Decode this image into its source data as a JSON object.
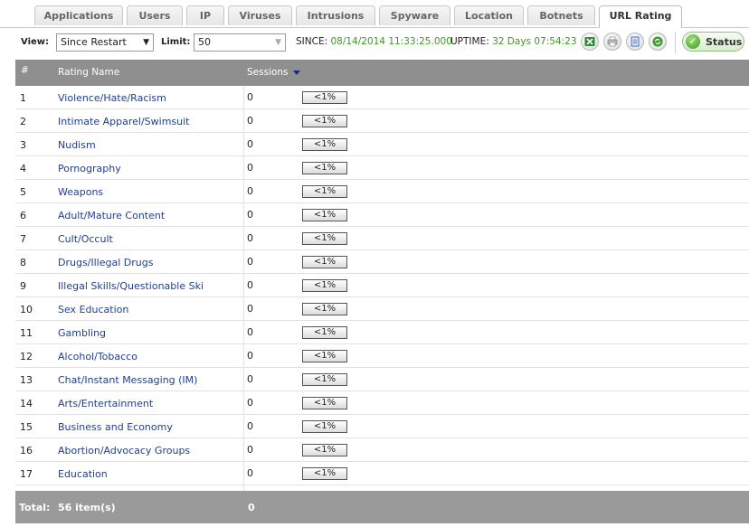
{
  "tabs": [
    {
      "label": "Applications",
      "active": false
    },
    {
      "label": "Users",
      "active": false
    },
    {
      "label": "IP",
      "active": false
    },
    {
      "label": "Viruses",
      "active": false
    },
    {
      "label": "Intrusions",
      "active": false
    },
    {
      "label": "Spyware",
      "active": false
    },
    {
      "label": "Location",
      "active": false
    },
    {
      "label": "Botnets",
      "active": false
    },
    {
      "label": "URL Rating",
      "active": true
    }
  ],
  "toolbar": {
    "view_label": "View:",
    "view_value": "Since Restart",
    "limit_label": "Limit:",
    "limit_value": "50",
    "since_label": "SINCE:",
    "since_value": "08/14/2014 11:33:25.000",
    "uptime_label": "UPTIME:",
    "uptime_value": "32 Days 07:54:23",
    "status_label": "Status",
    "icons": [
      "excel-export-icon",
      "print-icon",
      "list-icon",
      "refresh-icon"
    ]
  },
  "table": {
    "headers": {
      "num": "#",
      "name": "Rating Name",
      "sessions": "Sessions"
    },
    "rows": [
      {
        "num": "1",
        "name": "Violence/Hate/Racism",
        "sessions": "0",
        "pct": "<1%"
      },
      {
        "num": "2",
        "name": "Intimate Apparel/Swimsuit",
        "sessions": "0",
        "pct": "<1%"
      },
      {
        "num": "3",
        "name": "Nudism",
        "sessions": "0",
        "pct": "<1%"
      },
      {
        "num": "4",
        "name": "Pornography",
        "sessions": "0",
        "pct": "<1%"
      },
      {
        "num": "5",
        "name": "Weapons",
        "sessions": "0",
        "pct": "<1%"
      },
      {
        "num": "6",
        "name": "Adult/Mature Content",
        "sessions": "0",
        "pct": "<1%"
      },
      {
        "num": "7",
        "name": "Cult/Occult",
        "sessions": "0",
        "pct": "<1%"
      },
      {
        "num": "8",
        "name": "Drugs/Illegal Drugs",
        "sessions": "0",
        "pct": "<1%"
      },
      {
        "num": "9",
        "name": "Illegal Skills/Questionable Ski",
        "sessions": "0",
        "pct": "<1%"
      },
      {
        "num": "10",
        "name": "Sex Education",
        "sessions": "0",
        "pct": "<1%"
      },
      {
        "num": "11",
        "name": "Gambling",
        "sessions": "0",
        "pct": "<1%"
      },
      {
        "num": "12",
        "name": "Alcohol/Tobacco",
        "sessions": "0",
        "pct": "<1%"
      },
      {
        "num": "13",
        "name": "Chat/Instant Messaging (IM)",
        "sessions": "0",
        "pct": "<1%"
      },
      {
        "num": "14",
        "name": "Arts/Entertainment",
        "sessions": "0",
        "pct": "<1%"
      },
      {
        "num": "15",
        "name": "Business and Economy",
        "sessions": "0",
        "pct": "<1%"
      },
      {
        "num": "16",
        "name": "Abortion/Advocacy Groups",
        "sessions": "0",
        "pct": "<1%"
      },
      {
        "num": "17",
        "name": "Education",
        "sessions": "0",
        "pct": "<1%"
      }
    ],
    "footer": {
      "total_label": "Total:",
      "items": "56 item(s)",
      "sessions_total": "0"
    }
  },
  "colors": {
    "link": "#1f3f8f",
    "accent_green": "#3b9a1f",
    "header_bg": "#8f8f8f"
  }
}
